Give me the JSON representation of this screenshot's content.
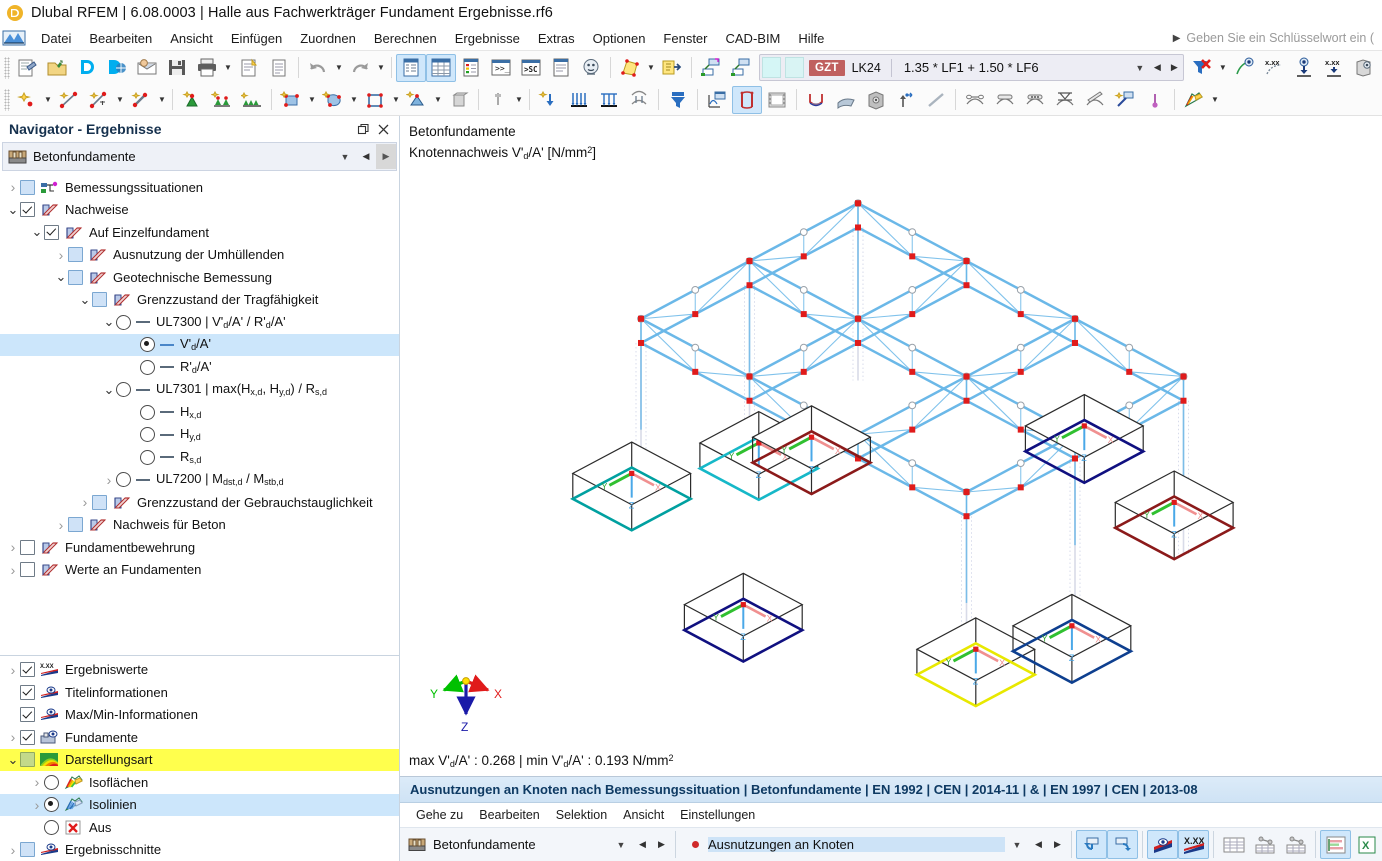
{
  "window": {
    "title": "Dlubal RFEM | 6.08.0003 | Halle aus Fachwerkträger Fundament Ergebnisse.rf6",
    "app_icon": "dlubal-logo-icon"
  },
  "menubar": {
    "items": [
      "Datei",
      "Bearbeiten",
      "Ansicht",
      "Einfügen",
      "Zuordnen",
      "Berechnen",
      "Ergebnisse",
      "Extras",
      "Optionen",
      "Fenster",
      "CAD-BIM",
      "Hilfe"
    ],
    "search_placeholder": "Geben Sie ein Schlüsselwort ein ("
  },
  "toolbar": {
    "load_combo": {
      "badge": "GZT",
      "code": "LK24",
      "expression": "1.35 * LF1 + 1.50 * LF6"
    },
    "row1_icons": [
      "new-model-icon",
      "open-folder-icon",
      "dlubal-center-icon",
      "dlubal-model-icon",
      "model-info-icon",
      "save-icon",
      "print-icon",
      "new-report-icon",
      "document-icon",
      "undo-icon",
      "redo-icon",
      "navigator-data-icon",
      "table-grid-icon",
      "render-table-icon",
      "console-icon",
      "script-sc-icon",
      "report-icon",
      "globe-support-icon",
      "section-view-icon",
      "export-icon"
    ],
    "row2_icons": [
      "new-node-icon",
      "new-line-icon",
      "new-line-dim-icon",
      "new-member-icon",
      "new-support-icon",
      "new-nodal-support-icon",
      "new-line-support-icon",
      "new-surface-icon",
      "new-solid-icon",
      "new-opening-icon",
      "new-section-icon",
      "delete-icon",
      "pin-icon",
      "new-load-icon",
      "member-load-icon",
      "line-load-icon",
      "surface-load-icon",
      "load-wizard-icon",
      "filter-icon",
      "diagram-icon",
      "deformation-icon",
      "animation-icon",
      "result-diagram-icon",
      "surface-result-icon",
      "solid-result-icon",
      "support-reaction-icon",
      "line-result-icon",
      "deform-compare-1-icon",
      "deform-compare-2-icon",
      "deform-compare-3-icon",
      "deform-compare-4-icon",
      "deform-compare-5-icon",
      "result-tool-icon",
      "marker-icon",
      "render-style-icon"
    ]
  },
  "navigator": {
    "title": "Navigator - Ergebnisse",
    "header_buttons": [
      "restore-icon",
      "close-icon"
    ],
    "combo": {
      "icon": "concrete-foundation-icon",
      "value": "Betonfundamente"
    },
    "tree": [
      {
        "id": "bemessungssituationen",
        "label": "Bemessungssituationen",
        "indent": 0,
        "expander": "collapsed",
        "control": "checkbox",
        "state": "blue",
        "icon": "design-situation-icon"
      },
      {
        "id": "nachweise",
        "label": "Nachweise",
        "indent": 0,
        "expander": "expanded",
        "control": "checkbox",
        "state": "checked",
        "icon": "design-check-icon"
      },
      {
        "id": "auf-einzelfundament",
        "label": "Auf Einzelfundament",
        "indent": 1,
        "expander": "expanded",
        "control": "checkbox",
        "state": "checked",
        "icon": "design-check-icon"
      },
      {
        "id": "ausnutzung-der-umhuellenden",
        "label": "Ausnutzung der Umhüllenden",
        "indent": 2,
        "expander": "collapsed",
        "control": "checkbox",
        "state": "blue",
        "icon": "design-check-icon"
      },
      {
        "id": "geotechnische-bemessung",
        "label": "Geotechnische Bemessung",
        "indent": 2,
        "expander": "expanded",
        "control": "checkbox",
        "state": "blue",
        "icon": "design-check-icon"
      },
      {
        "id": "grenzzustand-der-tragfaehigkeit",
        "label": "Grenzzustand der Tragfähigkeit",
        "indent": 3,
        "expander": "expanded",
        "control": "checkbox",
        "state": "blue",
        "icon": "design-check-icon"
      },
      {
        "id": "ul7300",
        "label": "UL7300 | V'<sub>d</sub>/A' / R'<sub>d</sub>/A'",
        "html": true,
        "indent": 4,
        "expander": "expanded",
        "control": "radio",
        "state": "off",
        "icon": "line-dash"
      },
      {
        "id": "vda",
        "label": "V'<sub>d</sub>/A'",
        "html": true,
        "indent": 5,
        "expander": "none",
        "control": "radio",
        "state": "on",
        "icon": "line-dash-blue",
        "selected": true
      },
      {
        "id": "rda",
        "label": "R'<sub>d</sub>/A'",
        "html": true,
        "indent": 5,
        "expander": "none",
        "control": "radio",
        "state": "off",
        "icon": "line-dash"
      },
      {
        "id": "ul7301",
        "label": "UL7301 | max(H<sub>x,d</sub>, H<sub>y,d</sub>) / R<sub>s,d</sub>",
        "html": true,
        "indent": 4,
        "expander": "expanded",
        "control": "radio",
        "state": "off",
        "icon": "line-dash"
      },
      {
        "id": "hxd",
        "label": "H<sub>x,d</sub>",
        "html": true,
        "indent": 5,
        "expander": "none",
        "control": "radio",
        "state": "off",
        "icon": "line-dash"
      },
      {
        "id": "hyd",
        "label": "H<sub>y,d</sub>",
        "html": true,
        "indent": 5,
        "expander": "none",
        "control": "radio",
        "state": "off",
        "icon": "line-dash"
      },
      {
        "id": "rsd",
        "label": "R<sub>s,d</sub>",
        "html": true,
        "indent": 5,
        "expander": "none",
        "control": "radio",
        "state": "off",
        "icon": "line-dash"
      },
      {
        "id": "ul7200",
        "label": "UL7200 | M<sub>dst,d</sub> / M<sub>stb,d</sub>",
        "html": true,
        "indent": 4,
        "expander": "collapsed",
        "control": "radio",
        "state": "off",
        "icon": "line-dash"
      },
      {
        "id": "grenzzustand-der-gebrauchstauglichkeit",
        "label": "Grenzzustand der Gebrauchstauglichkeit",
        "indent": 3,
        "expander": "collapsed",
        "control": "checkbox",
        "state": "blue",
        "icon": "design-check-icon"
      },
      {
        "id": "nachweis-fuer-beton",
        "label": "Nachweis für Beton",
        "indent": 2,
        "expander": "collapsed",
        "control": "checkbox",
        "state": "blue",
        "icon": "design-check-icon"
      },
      {
        "id": "fundamentbewehrung",
        "label": "Fundamentbewehrung",
        "indent": 0,
        "expander": "collapsed",
        "control": "checkbox",
        "state": "off",
        "icon": "design-check-icon"
      },
      {
        "id": "werte-an-fundamenten",
        "label": "Werte an Fundamenten",
        "indent": 0,
        "expander": "collapsed",
        "control": "checkbox",
        "state": "off",
        "icon": "design-check-icon"
      }
    ],
    "tree_bottom": [
      {
        "id": "ergebniswerte",
        "label": "Ergebniswerte",
        "indent": 0,
        "expander": "collapsed",
        "control": "checkbox",
        "state": "checked",
        "icon": "values-xxx-icon"
      },
      {
        "id": "titelinformationen",
        "label": "Titelinformationen",
        "indent": 0,
        "expander": "none",
        "control": "checkbox",
        "state": "checked",
        "icon": "eye-label-icon"
      },
      {
        "id": "max-min-informationen",
        "label": "Max/Min-Informationen",
        "indent": 0,
        "expander": "none",
        "control": "checkbox",
        "state": "checked",
        "icon": "eye-label-icon"
      },
      {
        "id": "fundamente",
        "label": "Fundamente",
        "indent": 0,
        "expander": "collapsed",
        "control": "checkbox",
        "state": "checked",
        "icon": "foundation-eye-icon"
      },
      {
        "id": "darstellungsart",
        "label": "Darstellungsart",
        "indent": 0,
        "expander": "expanded",
        "control": "checkbox",
        "state": "green",
        "icon": "isoband-icon",
        "highlight": true
      },
      {
        "id": "isoflaechen",
        "label": "Isoflächen",
        "indent": 1,
        "expander": "collapsed",
        "control": "radio",
        "state": "off",
        "icon": "isoflaechen-icon"
      },
      {
        "id": "isolinien",
        "label": "Isolinien",
        "indent": 1,
        "expander": "collapsed",
        "control": "radio",
        "state": "on",
        "icon": "isolinien-icon",
        "selected": true
      },
      {
        "id": "aus",
        "label": "Aus",
        "indent": 1,
        "expander": "none",
        "control": "radio",
        "state": "off",
        "icon": "red-x-icon"
      },
      {
        "id": "ergebnisschnitte",
        "label": "Ergebnisschnitte",
        "indent": 0,
        "expander": "collapsed",
        "control": "checkbox",
        "state": "blue",
        "icon": "eye-label-icon"
      }
    ]
  },
  "viewport": {
    "title_line1": "Betonfundamente",
    "title_line2_prefix": "Knotennachweis V'",
    "title_line2_sub": "d",
    "title_line2_suffix": "/A' [N/mm",
    "title_line2_sup": "2",
    "title_line2_end": "]",
    "maxmin": "max V'd/A' : 0.268 | min V'd/A' : 0.193 N/mm2",
    "max_label": "max V'",
    "max_value": "0.268",
    "min_label": "min V'",
    "min_value": "0.193",
    "unit": "N/mm",
    "axes": {
      "x": "X",
      "y": "Y",
      "z": "Z"
    },
    "colors": {
      "member": "#6bb8e8",
      "node": "#e01b1b",
      "foundation_outline": "#2b2b2b",
      "axis_x": "#e01b1b",
      "axis_y": "#00c000",
      "axis_z": "#1a1aa8"
    },
    "foundation_isocolors": [
      "#8b1a1a",
      "#00a0a0",
      "#16b8c8",
      "#e8e800",
      "#101080",
      "#0e3f8f"
    ]
  },
  "results_panel": {
    "heading": "Ausnutzungen an Knoten nach Bemessungssituation | Betonfundamente | EN 1992 | CEN | 2014-11 | & | EN 1997 | CEN | 2013-08",
    "menu": [
      "Gehe zu",
      "Bearbeiten",
      "Selektion",
      "Ansicht",
      "Einstellungen"
    ],
    "combo_left": {
      "icon": "concrete-foundation-icon",
      "value": "Betonfundamente"
    },
    "combo_right": {
      "icon": "red-dot-icon",
      "value": "Ausnutzungen an Knoten"
    },
    "buttons": [
      "undo-select-icon",
      "redo-select-icon",
      "show-results-icon",
      "values-xxx-icon",
      "table-full-icon",
      "table-chain-1-icon",
      "table-chain-2-icon",
      "report-bars-icon",
      "excel-export-icon"
    ]
  }
}
